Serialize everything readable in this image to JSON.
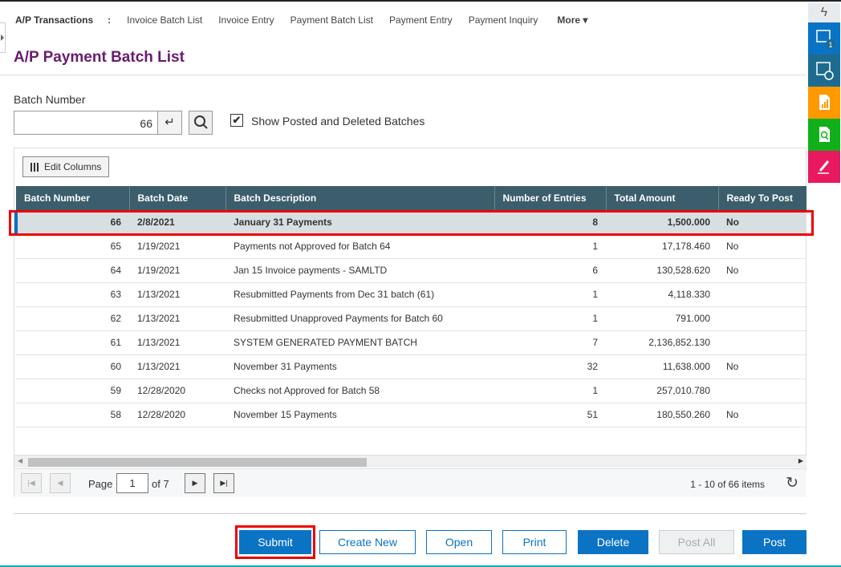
{
  "nav": {
    "title": "A/P Transactions",
    "sep": ":",
    "items": [
      "Invoice Batch List",
      "Invoice Entry",
      "Payment Batch List",
      "Payment Entry",
      "Payment Inquiry"
    ],
    "more": "More ▾"
  },
  "page_title": "A/P Payment Batch List",
  "filter": {
    "label": "Batch Number",
    "value": "66",
    "show_posted_label": "Show Posted and Deleted Batches",
    "show_posted_checked": true
  },
  "grid": {
    "edit_columns": "Edit Columns",
    "columns": [
      "Batch Number",
      "Batch Date",
      "Batch Description",
      "Number of Entries",
      "Total Amount",
      "Ready To Post"
    ],
    "rows": [
      [
        "66",
        "2/8/2021",
        "January 31 Payments",
        "8",
        "1,500.000",
        "No"
      ],
      [
        "65",
        "1/19/2021",
        "Payments not Approved for Batch 64",
        "1",
        "17,178.460",
        "No"
      ],
      [
        "64",
        "1/19/2021",
        "Jan 15 Invoice payments - SAMLTD",
        "6",
        "130,528.620",
        "No"
      ],
      [
        "63",
        "1/13/2021",
        "Resubmitted Payments from Dec 31 batch (61)",
        "1",
        "4,118.330",
        ""
      ],
      [
        "62",
        "1/13/2021",
        "Resubmitted Unapproved Payments for Batch 60",
        "1",
        "791.000",
        ""
      ],
      [
        "61",
        "1/13/2021",
        "SYSTEM GENERATED PAYMENT BATCH",
        "7",
        "2,136,852.130",
        ""
      ],
      [
        "60",
        "1/13/2021",
        "November 31 Payments",
        "32",
        "11,638.000",
        "No"
      ],
      [
        "59",
        "12/28/2020",
        "Checks not Approved for Batch 58",
        "1",
        "257,010.780",
        ""
      ],
      [
        "58",
        "12/28/2020",
        "November 15 Payments",
        "51",
        "180,550.260",
        "No"
      ]
    ],
    "selected_row": 0
  },
  "pager": {
    "page_label": "Page",
    "page": "1",
    "of": "of 7",
    "summary": "1 - 10 of 66 items"
  },
  "buttons": {
    "submit": "Submit",
    "create_new": "Create New",
    "open": "Open",
    "print": "Print",
    "delete": "Delete",
    "post_all": "Post All",
    "post": "Post"
  },
  "sidebar": {
    "badge": "1",
    "colors": [
      "#e8ebee",
      "#0b73c4",
      "#1d6b8f",
      "#ff9900",
      "#11b01b",
      "#e8195e"
    ]
  }
}
